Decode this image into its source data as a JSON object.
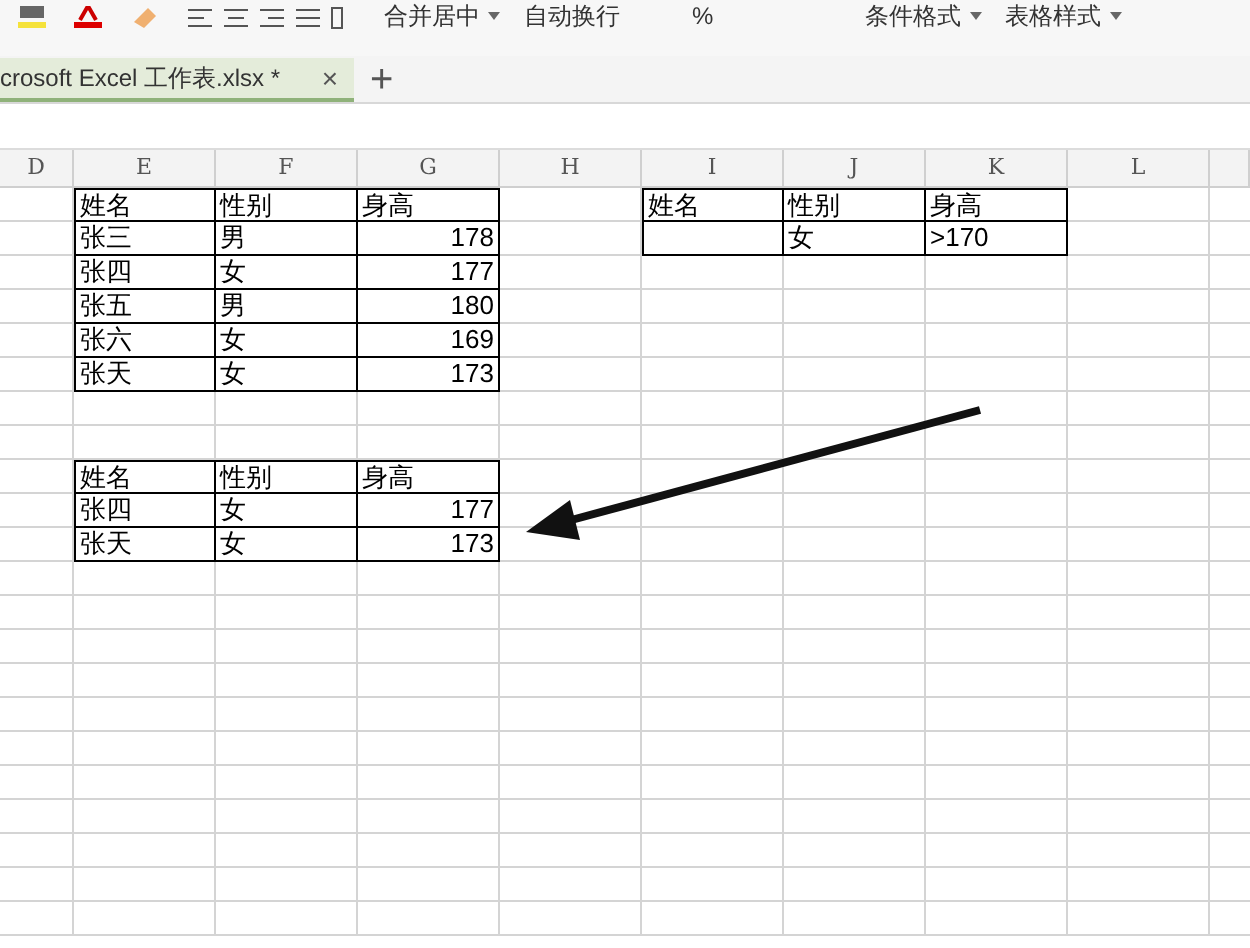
{
  "toolbar": {
    "buttons": [
      {
        "label": "合并居中",
        "dropdown": true
      },
      {
        "label": "自动换行",
        "dropdown": false
      },
      {
        "label": "%",
        "dropdown": false
      },
      {
        "label": "条件格式",
        "dropdown": true
      },
      {
        "label": "表格样式",
        "dropdown": true
      }
    ]
  },
  "tabs": [
    {
      "label": "crosoft Excel 工作表.xlsx *",
      "selected": true,
      "close": "×"
    }
  ],
  "new_tab": "+",
  "sheet": {
    "columns": [
      "D",
      "E",
      "F",
      "G",
      "H",
      "I",
      "J",
      "K",
      "L",
      ""
    ],
    "rows": [
      {
        "cells": {
          "E": "姓名",
          "F": "性别",
          "G": "身高",
          "I": "姓名",
          "J": "性别",
          "K": "身高"
        }
      },
      {
        "cells": {
          "E": "张三",
          "F": "男",
          "G": "178",
          "J": "女",
          "K": ">170"
        }
      },
      {
        "cells": {
          "E": "张四",
          "F": "女",
          "G": "177"
        }
      },
      {
        "cells": {
          "E": "张五",
          "F": "男",
          "G": "180"
        }
      },
      {
        "cells": {
          "E": "张六",
          "F": "女",
          "G": "169"
        }
      },
      {
        "cells": {
          "E": "张天",
          "F": "女",
          "G": "173"
        }
      },
      {
        "cells": {}
      },
      {
        "cells": {}
      },
      {
        "cells": {
          "E": "姓名",
          "F": "性别",
          "G": "身高"
        }
      },
      {
        "cells": {
          "E": "张四",
          "F": "女",
          "G": "177"
        }
      },
      {
        "cells": {
          "E": "张天",
          "F": "女",
          "G": "173"
        }
      },
      {
        "cells": {}
      },
      {
        "cells": {}
      },
      {
        "cells": {}
      },
      {
        "cells": {}
      },
      {
        "cells": {}
      },
      {
        "cells": {}
      },
      {
        "cells": {}
      },
      {
        "cells": {}
      },
      {
        "cells": {}
      },
      {
        "cells": {}
      },
      {
        "cells": {}
      }
    ]
  }
}
